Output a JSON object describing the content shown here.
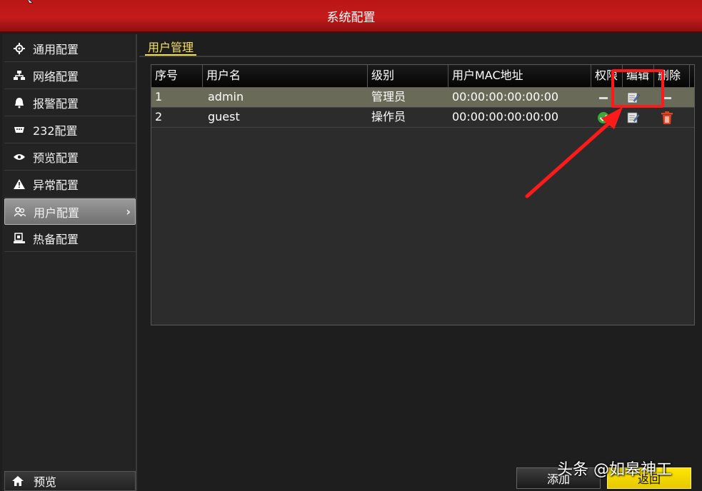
{
  "window": {
    "title": "系统配置"
  },
  "sidebar": {
    "items": [
      {
        "label": "通用配置",
        "icon": "gear-icon"
      },
      {
        "label": "网络配置",
        "icon": "network-icon"
      },
      {
        "label": "报警配置",
        "icon": "alarm-icon"
      },
      {
        "label": "232配置",
        "icon": "serial-port-icon"
      },
      {
        "label": "预览配置",
        "icon": "eye-icon"
      },
      {
        "label": "异常配置",
        "icon": "warning-icon"
      },
      {
        "label": "用户配置",
        "icon": "users-icon",
        "active": true
      },
      {
        "label": "热备配置",
        "icon": "hot-spare-icon"
      }
    ],
    "preview_label": "预览"
  },
  "main": {
    "section_tab": "用户管理",
    "columns": [
      "序号",
      "用户名",
      "级别",
      "用户MAC地址",
      "权限",
      "编辑",
      "删除"
    ],
    "rows": [
      {
        "index": "1",
        "username": "admin",
        "level": "管理员",
        "mac": "00:00:00:00:00:00",
        "permission": "none",
        "edit": "edit-icon",
        "delete": "none"
      },
      {
        "index": "2",
        "username": "guest",
        "level": "操作员",
        "mac": "00:00:00:00:00:00",
        "permission": "check-icon",
        "edit": "edit-icon",
        "delete": "trash-icon"
      }
    ],
    "add_label": "添加",
    "back_label": "返回"
  },
  "watermark": "头条 @如皋神工",
  "colors": {
    "title_red": "#c51b1b",
    "accent_yellow": "#f5e25a",
    "selected_row": "#6a6a58",
    "highlight_red": "#ff1a1a"
  }
}
